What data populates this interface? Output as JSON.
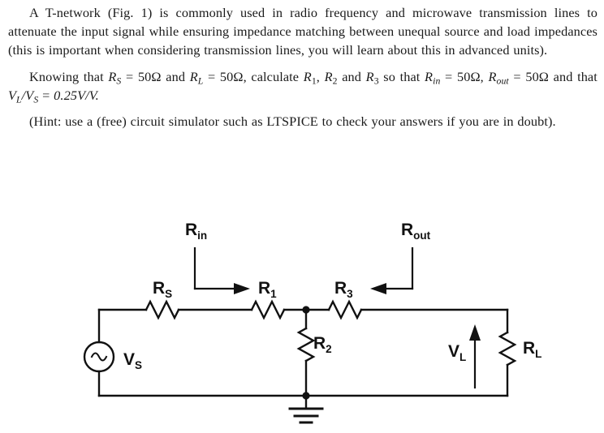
{
  "document": {
    "paragraphs": [
      {
        "id": "intro",
        "text": "A T-network (Fig. 1) is commonly used in radio frequency and microwave transmission lines to attenuate the input signal while ensuring impedance matching between unequal source and load impedances (this is important when considering transmission lines, you will learn about this in advanced units)."
      },
      {
        "id": "hint",
        "text": "(Hint: use a (free) circuit simulator such as LTSPICE to check your answers if you are in doubt)."
      }
    ],
    "problem_statement": {
      "lead": "Knowing that",
      "rs_symbol": "R",
      "rs_sub": "S",
      "rs_value": "50Ω",
      "and_1": "and",
      "rl_symbol": "R",
      "rl_sub": "L",
      "rl_value": "50Ω",
      "calculate": ", calculate",
      "r1_symbol": "R",
      "r1_sub": "1",
      "comma": ",",
      "r2_symbol": "R",
      "r2_sub": "2",
      "and_2": "and",
      "r3_symbol": "R",
      "r3_sub": "3",
      "so_that": "so that",
      "rin_symbol": "R",
      "rin_sub": "in",
      "rin_value": "50Ω,",
      "rout_symbol": "R",
      "rout_sub": "out",
      "rout_value": "50Ω",
      "and_that": "and that",
      "vl_symbol": "V",
      "vl_sub": "L",
      "slash": "/",
      "vs_symbol": "V",
      "vs_sub": "S",
      "gain_value": "0.25V/V.",
      "equals": "="
    }
  },
  "circuit": {
    "title": "T-network attenuator schematic",
    "labels": {
      "rin": {
        "main": "R",
        "sub": "in"
      },
      "rout": {
        "main": "R",
        "sub": "out"
      },
      "rs": {
        "main": "R",
        "sub": "S"
      },
      "r1": {
        "main": "R",
        "sub": "1"
      },
      "r2": {
        "main": "R",
        "sub": "2"
      },
      "r3": {
        "main": "R",
        "sub": "3"
      },
      "rl": {
        "main": "R",
        "sub": "L"
      },
      "vs": {
        "main": "V",
        "sub": "S"
      },
      "vl": {
        "main": "V",
        "sub": "L"
      }
    },
    "components": [
      {
        "name": "voltage-source-vs",
        "type": "ac-source"
      },
      {
        "name": "resistor-rs",
        "type": "resistor",
        "orientation": "horizontal"
      },
      {
        "name": "resistor-r1",
        "type": "resistor",
        "orientation": "horizontal"
      },
      {
        "name": "resistor-r3",
        "type": "resistor",
        "orientation": "horizontal"
      },
      {
        "name": "resistor-r2",
        "type": "resistor",
        "orientation": "vertical"
      },
      {
        "name": "resistor-rl",
        "type": "resistor",
        "orientation": "vertical"
      },
      {
        "name": "ground-symbol",
        "type": "ground"
      }
    ],
    "colors": {
      "wire": "#111111",
      "label": "#111111",
      "background": "#ffffff"
    }
  }
}
